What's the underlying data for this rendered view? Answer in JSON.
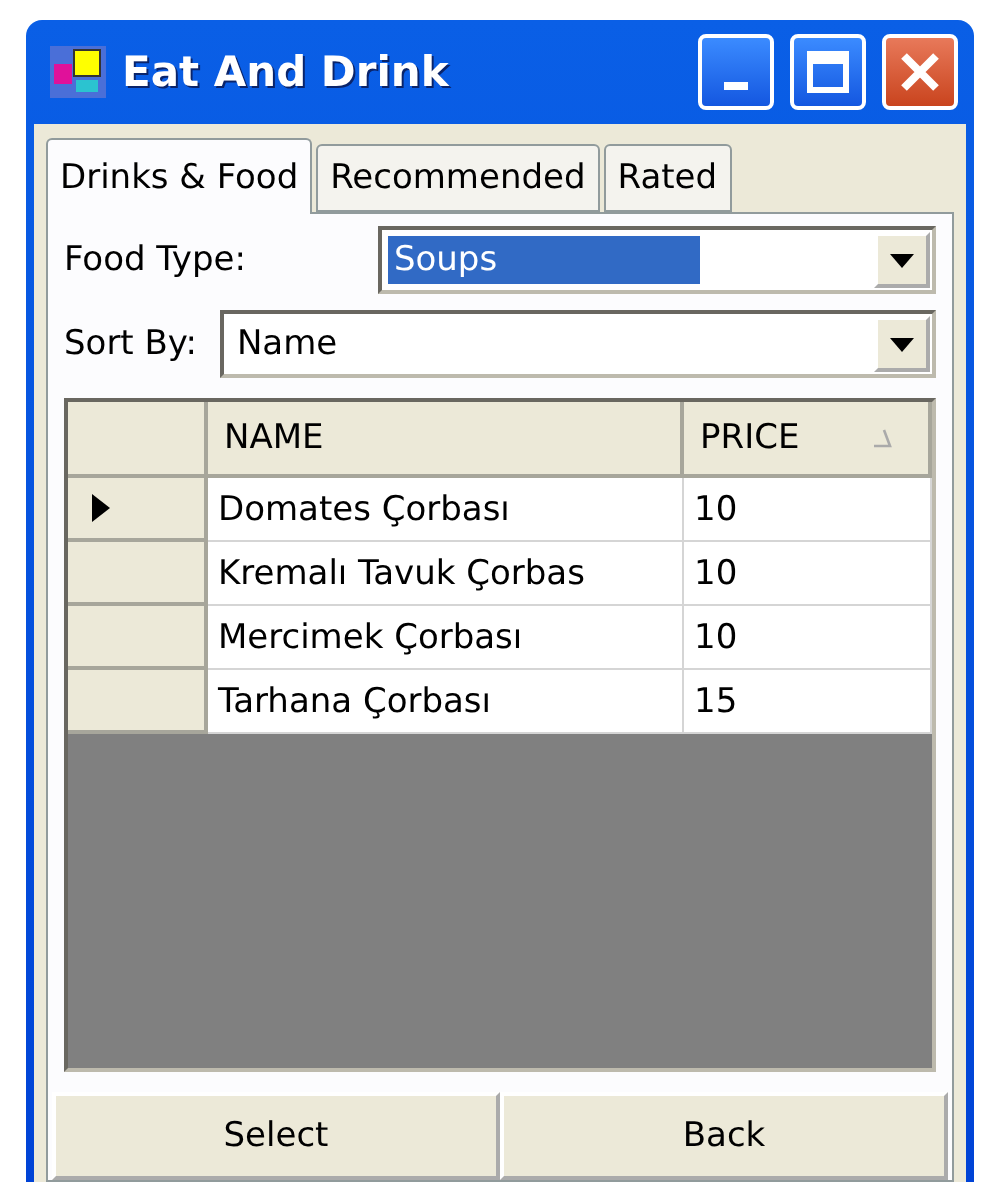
{
  "window": {
    "title": "Eat And Drink"
  },
  "tabs": [
    {
      "label": "Drinks & Food",
      "selected": true
    },
    {
      "label": "Recommended",
      "selected": false
    },
    {
      "label": "Rated",
      "selected": false
    }
  ],
  "food_type": {
    "label": "Food Type:",
    "value": "Soups",
    "text_selected": true
  },
  "sort_by": {
    "label": "Sort By:",
    "value": "Name",
    "text_selected": false
  },
  "table": {
    "columns": [
      {
        "label": "NAME",
        "sorted": false
      },
      {
        "label": "PRICE",
        "sorted": true
      }
    ],
    "rows": [
      {
        "selected": true,
        "cells": [
          "Domates Çorbası",
          "10"
        ]
      },
      {
        "selected": false,
        "cells": [
          "Kremalı Tavuk Çorbas",
          "10"
        ]
      },
      {
        "selected": false,
        "cells": [
          "Mercimek Çorbası",
          "10"
        ]
      },
      {
        "selected": false,
        "cells": [
          "Tarhana Çorbası",
          "15"
        ]
      }
    ]
  },
  "buttons": [
    "Select",
    "Back"
  ]
}
